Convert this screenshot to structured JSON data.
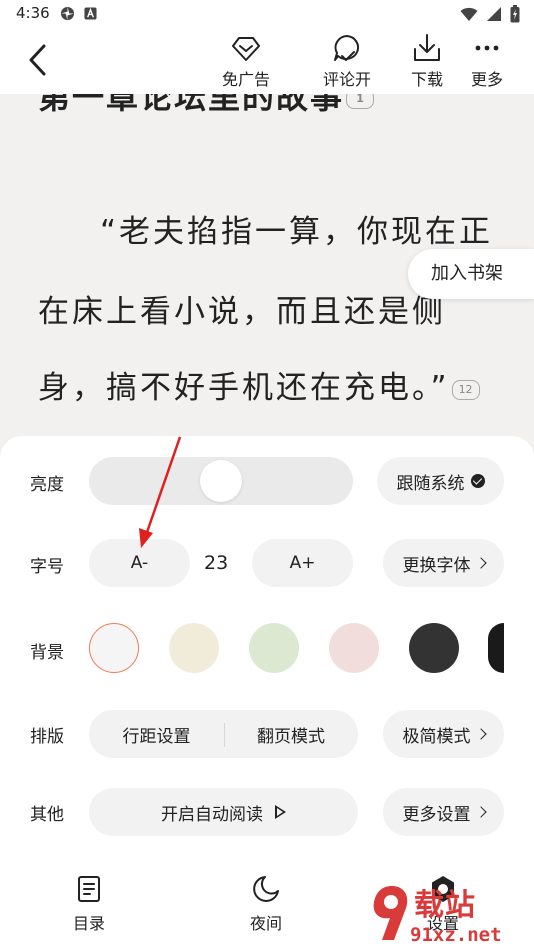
{
  "status_bar": {
    "time": "4:36"
  },
  "toolbar": {
    "items": [
      {
        "label": "免广告",
        "icon": "ad-free-icon"
      },
      {
        "label": "评论开",
        "icon": "comment-icon"
      },
      {
        "label": "下载",
        "icon": "download-icon"
      },
      {
        "label": "更多",
        "icon": "more-icon"
      }
    ]
  },
  "content": {
    "chapter_title": "第一章论坛里的故事",
    "chapter_comment_count": "1",
    "lines": [
      "“老夫掐指一算，你现在正",
      "在床上看小说，而且还是侧",
      "身，搞不好手机还在充电。”"
    ],
    "paragraph_comment_count": "12",
    "add_to_shelf": "加入书架"
  },
  "settings": {
    "brightness": {
      "label": "亮度",
      "level": 0.5,
      "follow_system": "跟随系统"
    },
    "font_size": {
      "label": "字号",
      "decrease": "A-",
      "value": "23",
      "increase": "A+",
      "change_font": "更换字体"
    },
    "background": {
      "label": "背景",
      "colors": [
        "#f5f5f5",
        "#f1ecd9",
        "#dde8d2",
        "#f2dddd",
        "#333333",
        "#1a1a1a"
      ],
      "selected_accent": "#f07b4f"
    },
    "layout": {
      "label": "排版",
      "line_spacing": "行距设置",
      "page_mode": "翻页模式",
      "minimal_mode": "极简模式"
    },
    "other": {
      "label": "其他",
      "auto_read": "开启自动阅读",
      "more_settings": "更多设置"
    }
  },
  "bottom_nav": {
    "items": [
      {
        "label": "目录",
        "icon": "catalog-icon"
      },
      {
        "label": "夜间",
        "icon": "moon-icon"
      },
      {
        "label": "设置",
        "icon": "settings-icon"
      }
    ]
  },
  "watermark": {
    "text": "载站",
    "url": "91xz.net"
  },
  "colors": {
    "annotation_arrow": "#e0201c",
    "accent": "#f07b4f"
  }
}
